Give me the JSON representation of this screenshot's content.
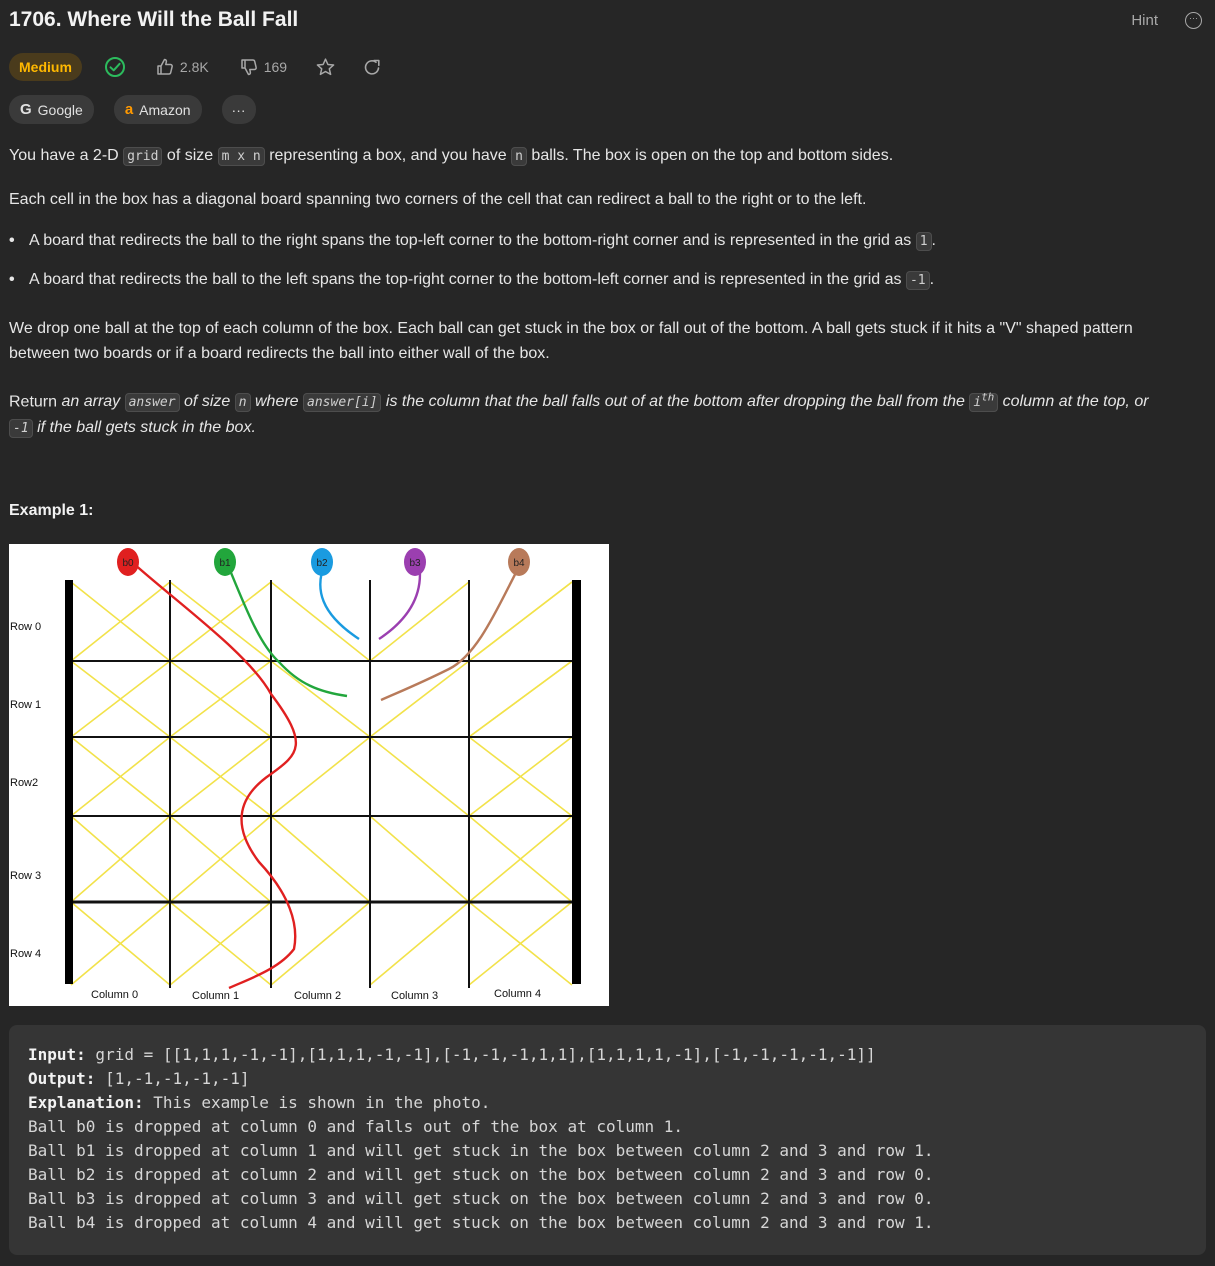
{
  "problem": {
    "title": "1706. Where Will the Ball Fall",
    "hint_label": "Hint",
    "difficulty": "Medium",
    "likes": "2.8K",
    "dislikes": "169",
    "colors": {
      "difficulty_text": "#ffb800",
      "solved_check": "#2cbb5d"
    }
  },
  "tags": [
    {
      "icon": "G",
      "label": "Google"
    },
    {
      "icon": "a",
      "label": "Amazon"
    },
    {
      "icon": "",
      "label": "···"
    }
  ],
  "description": {
    "p1_a": "You have a 2-D ",
    "p1_code1": "grid",
    "p1_b": " of size ",
    "p1_code2": "m x n",
    "p1_c": " representing a box, and you have ",
    "p1_code3": "n",
    "p1_d": " balls. The box is open on the top and bottom sides.",
    "p2": "Each cell in the box has a diagonal board spanning two corners of the cell that can redirect a ball to the right or to the left.",
    "b1_text": "A board that redirects the ball to the right spans the top-left corner to the bottom-right corner and is represented in the grid as ",
    "b1_code": "1",
    "b1_end": ".",
    "b2_text": "A board that redirects the ball to the left spans the top-right corner to the bottom-left corner and is represented in the grid as ",
    "b2_code": "-1",
    "b2_end": ".",
    "p3_line1": "We drop one ball at the top of each column of the box. Each ball can get stuck in the box or fall out of the bottom. A ball gets stuck if it hits a \"V\" shaped pattern",
    "p3_line2": "between two boards or if a board redirects the ball into either wall of the box.",
    "p4_a": "Return ",
    "p4_b": "an array ",
    "p4_code1": "answer",
    "p4_c": " of size ",
    "p4_code2": "n",
    "p4_d": " where ",
    "p4_code3": "answer[i]",
    "p4_e": " is the column that the ball falls out of at the bottom after dropping the ball from the ",
    "p4_code4a": "i",
    "p4_code4b": "th",
    "p4_f": " column at the top, or",
    "p4_code5": "-1",
    "p4_g": " if the ball gets stuck in the box."
  },
  "example": {
    "title": "Example 1:",
    "figure": {
      "balls": [
        {
          "label": "b0",
          "color": "#e02020"
        },
        {
          "label": "b1",
          "color": "#22a63c"
        },
        {
          "label": "b2",
          "color": "#1a9be0"
        },
        {
          "label": "b3",
          "color": "#9b3fb0"
        },
        {
          "label": "b4",
          "color": "#b87a5a"
        }
      ],
      "row_labels": [
        "Row 0",
        "Row 1",
        "Row2",
        "Row 3",
        "Row 4"
      ],
      "column_labels": [
        "Column 0",
        "Column 1",
        "Column 2",
        "Column 3",
        "Column 4"
      ]
    },
    "input_label": "Input:",
    "input_value": " grid = [[1,1,1,-1,-1],[1,1,1,-1,-1],[-1,-1,-1,1,1],[1,1,1,1,-1],[-1,-1,-1,-1,-1]]",
    "output_label": "Output:",
    "output_value": " [1,-1,-1,-1,-1]",
    "explanation_label": "Explanation:",
    "explanation_value": " This example is shown in the photo.",
    "lines": [
      "Ball b0 is dropped at column 0 and falls out of the box at column 1.",
      "Ball b1 is dropped at column 1 and will get stuck in the box between column 2 and 3 and row 1.",
      "Ball b2 is dropped at column 2 and will get stuck on the box between column 2 and 3 and row 0.",
      "Ball b3 is dropped at column 3 and will get stuck on the box between column 2 and 3 and row 0.",
      "Ball b4 is dropped at column 4 and will get stuck on the box between column 2 and 3 and row 1."
    ]
  }
}
